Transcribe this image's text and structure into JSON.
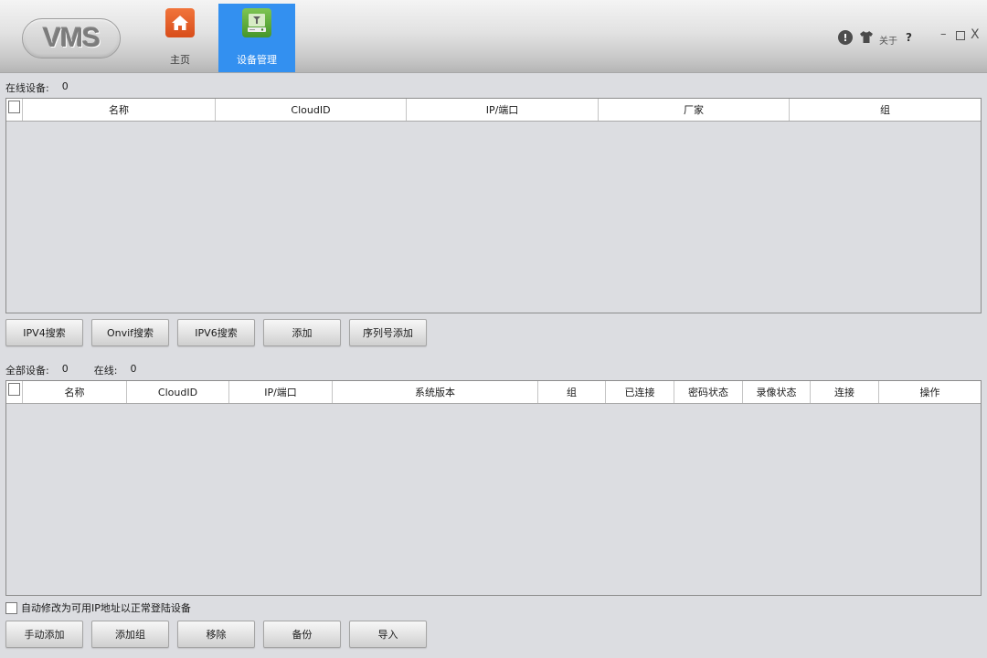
{
  "app": {
    "logo_text": "VMS"
  },
  "nav": {
    "tabs": [
      {
        "label": "主页",
        "icon": "home-icon",
        "active": false
      },
      {
        "label": "设备管理",
        "icon": "device-manager-icon",
        "active": true
      }
    ]
  },
  "window": {
    "about_label": "关于",
    "help_symbol": "?",
    "info_symbol": "!",
    "minimize_symbol": "–",
    "close_symbol": "X"
  },
  "online_section": {
    "label": "在线设备:",
    "count": "0",
    "columns": [
      "名称",
      "CloudID",
      "IP/端口",
      "厂家",
      "组"
    ],
    "buttons": [
      "IPV4搜索",
      "Onvif搜索",
      "IPV6搜索",
      "添加",
      "序列号添加"
    ]
  },
  "all_section": {
    "label": "全部设备:",
    "count": "0",
    "online_label": "在线:",
    "online_count": "0",
    "columns": [
      "名称",
      "CloudID",
      "IP/端口",
      "系统版本",
      "组",
      "已连接",
      "密码状态",
      "录像状态",
      "连接",
      "操作"
    ],
    "auto_modify_label": "自动修改为可用IP地址以正常登陆设备",
    "buttons": [
      "手动添加",
      "添加组",
      "移除",
      "备份",
      "导入"
    ]
  },
  "colors": {
    "active_tab": "#3390f0",
    "home_icon": "#e35b22",
    "device_icon": "#5aab38",
    "background": "#dcdde1"
  }
}
